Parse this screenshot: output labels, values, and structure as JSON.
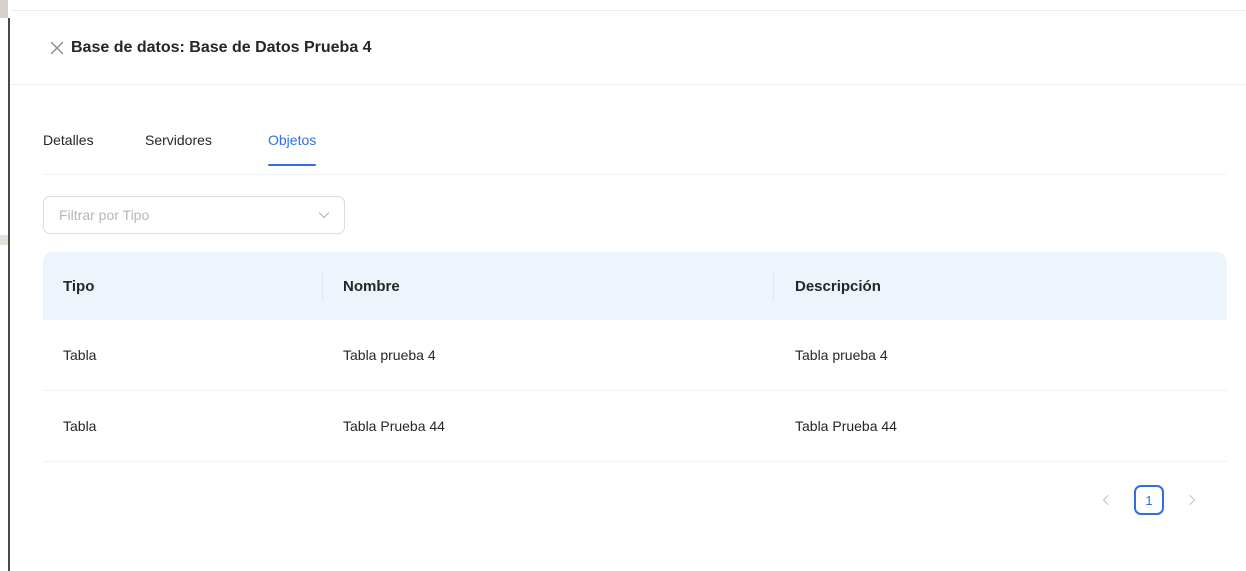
{
  "header": {
    "title": "Base de datos: Base de Datos Prueba 4",
    "close_icon": "close-icon"
  },
  "tabs": [
    {
      "label": "Detalles",
      "active": false
    },
    {
      "label": "Servidores",
      "active": false
    },
    {
      "label": "Objetos",
      "active": true
    }
  ],
  "filter": {
    "placeholder": "Filtrar por Tipo",
    "icon": "chevron-down-icon"
  },
  "table": {
    "columns": [
      "Tipo",
      "Nombre",
      "Descripción"
    ],
    "rows": [
      [
        "Tabla",
        "Tabla prueba 4",
        "Tabla prueba 4"
      ],
      [
        "Tabla",
        "Tabla Prueba 44",
        "Tabla Prueba 44"
      ]
    ]
  },
  "pagination": {
    "current_page": "1",
    "prev_icon": "chevron-left-icon",
    "next_icon": "chevron-right-icon"
  },
  "colors": {
    "accent": "#2f6fe4",
    "table_header_bg": "#eef4fc",
    "text": "#262626",
    "placeholder": "#b3b7bd"
  }
}
